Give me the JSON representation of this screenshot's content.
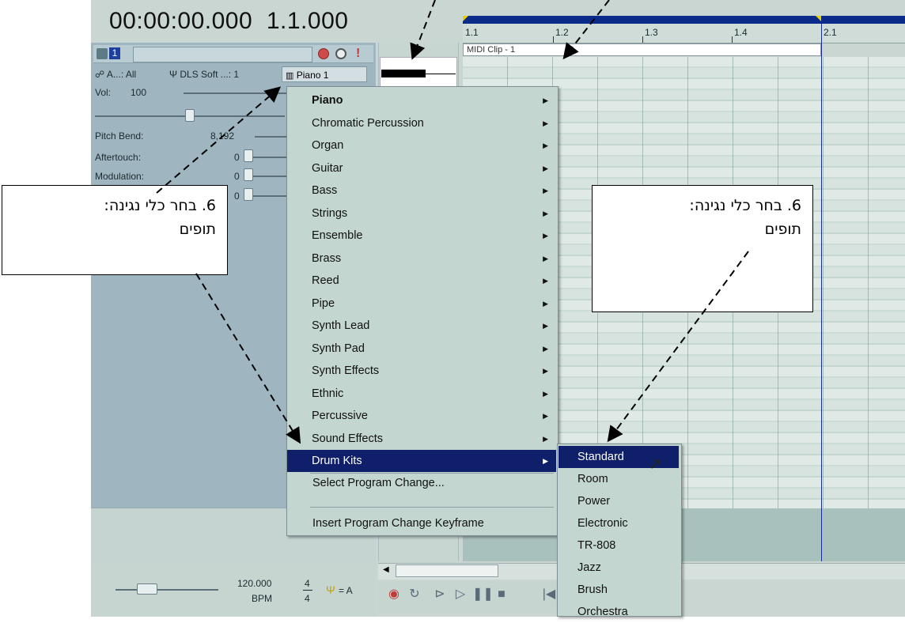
{
  "time_display": {
    "time": "00:00:00.000",
    "measure": "1.1.000"
  },
  "track": {
    "number": "1",
    "input_label": "A...: All",
    "output_label": "DLS Soft ...: 1",
    "instrument": "Piano 1",
    "vol_label": "Vol:",
    "vol_value": "100",
    "pitch_bend_label": "Pitch Bend:",
    "pitch_bend_value": "8,192",
    "aftertouch_label": "Aftertouch:",
    "aftertouch_value": "0",
    "modulation_label": "Modulation:",
    "modulation_value": "0",
    "fourth_value": "0",
    "icons": [
      "track-icon",
      "record-icon",
      "mute-icon",
      "solo-icon"
    ]
  },
  "tempo": {
    "value": "120.000",
    "unit": "BPM",
    "time_sig_num": "4",
    "time_sig_den": "4",
    "key": "= A"
  },
  "ruler": {
    "labels": [
      "1.1",
      "1.2",
      "1.3",
      "1.4",
      "2.1"
    ]
  },
  "clip": {
    "title": "MIDI Clip - 1"
  },
  "menu": {
    "items": [
      {
        "label": "Piano",
        "submenu": true,
        "bold": true
      },
      {
        "label": "Chromatic Percussion",
        "submenu": true
      },
      {
        "label": "Organ",
        "submenu": true
      },
      {
        "label": "Guitar",
        "submenu": true
      },
      {
        "label": "Bass",
        "submenu": true
      },
      {
        "label": "Strings",
        "submenu": true
      },
      {
        "label": "Ensemble",
        "submenu": true
      },
      {
        "label": "Brass",
        "submenu": true
      },
      {
        "label": "Reed",
        "submenu": true
      },
      {
        "label": "Pipe",
        "submenu": true
      },
      {
        "label": "Synth Lead",
        "submenu": true
      },
      {
        "label": "Synth Pad",
        "submenu": true
      },
      {
        "label": "Synth Effects",
        "submenu": true
      },
      {
        "label": "Ethnic",
        "submenu": true
      },
      {
        "label": "Percussive",
        "submenu": true
      },
      {
        "label": "Sound Effects",
        "submenu": true
      },
      {
        "label": "Drum Kits",
        "submenu": true,
        "selected": true
      }
    ],
    "select_program_change": "Select Program Change...",
    "insert_keyframe": "Insert Program Change Keyframe"
  },
  "submenu": {
    "items": [
      "Standard",
      "Room",
      "Power",
      "Electronic",
      "TR-808",
      "Jazz",
      "Brush",
      "Orchestra"
    ],
    "selected": "Standard"
  },
  "annotations": {
    "left_line1": "6. בחר כלי נגינה:",
    "left_line2": "תופים",
    "right_line1": "6. בחר כלי נגינה:",
    "right_line2": "תופים"
  },
  "colors": {
    "menu_highlight": "#0f1f6a",
    "timeline_bar": "#0b2b8a",
    "menu_bg": "#c3d6d0"
  }
}
